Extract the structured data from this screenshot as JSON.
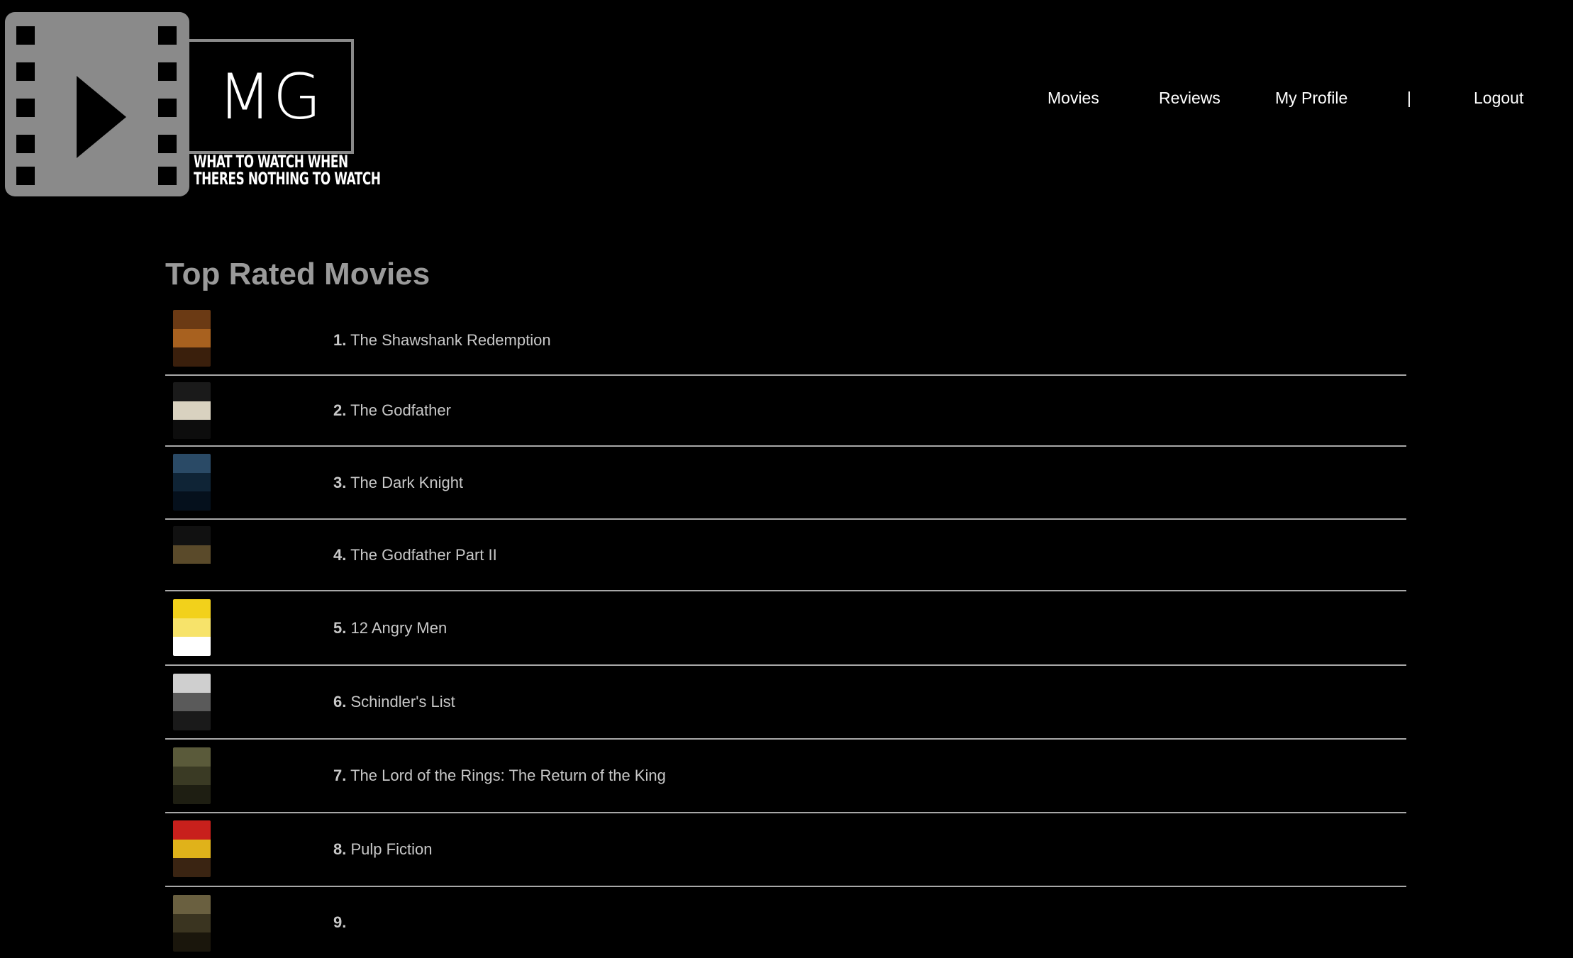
{
  "logo": {
    "monogram": "MG",
    "tagline_line1": "WHAT TO WATCH WHEN",
    "tagline_line2": "THERES NOTHING TO WATCH",
    "icon": "film-play-icon",
    "reel_color": "#8a8a8a"
  },
  "nav": {
    "movies": "Movies",
    "reviews": "Reviews",
    "my_profile": "My Profile",
    "separator": "|",
    "logout": "Logout"
  },
  "page": {
    "title": "Top Rated Movies"
  },
  "movies": [
    {
      "rank": "1.",
      "title": "The Shawshank Redemption",
      "poster_colors": [
        "#6b3a14",
        "#a8611f",
        "#3a1f0c"
      ]
    },
    {
      "rank": "2.",
      "title": "The Godfather",
      "poster_colors": [
        "#1a1a1a",
        "#d9d2c0",
        "#0d0d0d"
      ]
    },
    {
      "rank": "3.",
      "title": "The Dark Knight",
      "poster_colors": [
        "#2a4a66",
        "#0f2436",
        "#05101c"
      ]
    },
    {
      "rank": "4.",
      "title": "The Godfather Part II",
      "poster_colors": [
        "#111111",
        "#5a4a2a",
        "#000000"
      ]
    },
    {
      "rank": "5.",
      "title": "12 Angry Men",
      "poster_colors": [
        "#f2d11b",
        "#f7e36a",
        "#ffffff"
      ]
    },
    {
      "rank": "6.",
      "title": "Schindler's List",
      "poster_colors": [
        "#cfcfcf",
        "#5a5a5a",
        "#1a1a1a"
      ]
    },
    {
      "rank": "7.",
      "title": "The Lord of the Rings: The Return of the King",
      "poster_colors": [
        "#5a5a3a",
        "#3a3a24",
        "#1e1e12"
      ]
    },
    {
      "rank": "8.",
      "title": "Pulp Fiction",
      "poster_colors": [
        "#c8201c",
        "#e0b21a",
        "#3a2412"
      ]
    },
    {
      "rank": "9.",
      "title": "",
      "poster_colors": [
        "#6a6040",
        "#3a3420",
        "#1a160c"
      ]
    }
  ]
}
